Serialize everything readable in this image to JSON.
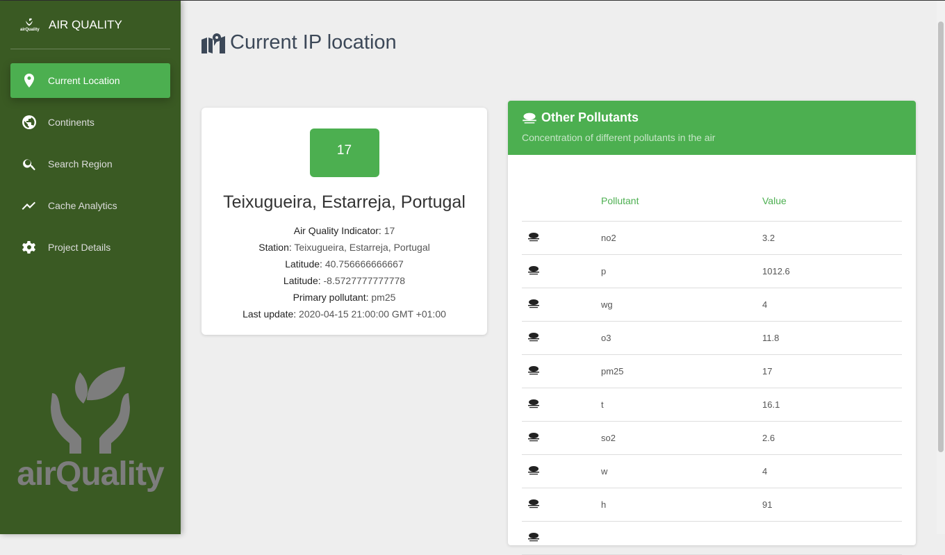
{
  "sidebar": {
    "brand": "AIR QUALITY",
    "logo_text": "airQuality",
    "items": [
      {
        "label": "Current Location",
        "icon": "map-marker-icon",
        "active": true
      },
      {
        "label": "Continents",
        "icon": "globe-icon"
      },
      {
        "label": "Search Region",
        "icon": "search-icon"
      },
      {
        "label": "Cache Analytics",
        "icon": "chart-line-icon"
      },
      {
        "label": "Project Details",
        "icon": "gear-icon"
      }
    ],
    "watermark": "airQuality"
  },
  "page": {
    "title": "Current IP location"
  },
  "location": {
    "aqi": "17",
    "place": "Teixugueira, Estarreja, Portugal",
    "fields": [
      {
        "label": "Air Quality Indicator:",
        "value": "17"
      },
      {
        "label": "Station:",
        "value": "Teixugueira, Estarreja, Portugal"
      },
      {
        "label": "Latitude:",
        "value": "40.756666666667"
      },
      {
        "label": "Latitude:",
        "value": "-8.5727777777778"
      },
      {
        "label": "Primary pollutant:",
        "value": "pm25"
      },
      {
        "label": "Last update:",
        "value": "2020-04-15 21:00:00 GMT +01:00"
      }
    ]
  },
  "pollutants": {
    "title": "Other Pollutants",
    "subtitle": "Concentration of different pollutants in the air",
    "columns": [
      "Pollutant",
      "Value"
    ],
    "rows": [
      [
        "no2",
        "3.2"
      ],
      [
        "p",
        "1012.6"
      ],
      [
        "wg",
        "4"
      ],
      [
        "o3",
        "11.8"
      ],
      [
        "pm25",
        "17"
      ],
      [
        "t",
        "16.1"
      ],
      [
        "so2",
        "2.6"
      ],
      [
        "w",
        "4"
      ],
      [
        "h",
        "91"
      ],
      [
        "",
        ""
      ]
    ]
  },
  "colors": {
    "accent": "#4caf50",
    "sidebar": "#3a5a23"
  }
}
